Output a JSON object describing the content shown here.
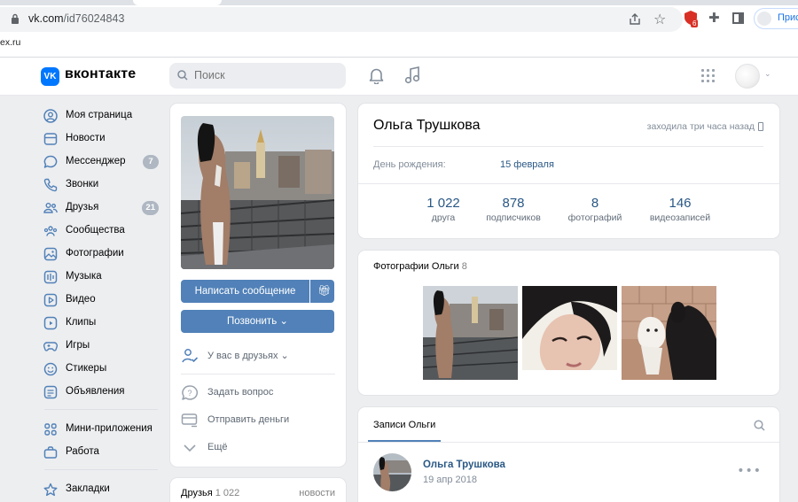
{
  "browser": {
    "url_host": "vk.com",
    "url_path": "/id76024843",
    "extension_badge": "6",
    "profile_label": "Прис",
    "bookmark_text": "ex.ru"
  },
  "header": {
    "logo_text": "VK",
    "brand": "вконтакте",
    "search_placeholder": "Поиск",
    "accent_color": "#0077ff"
  },
  "nav": {
    "items": [
      {
        "label": "Моя страница",
        "icon": "user-circle-icon"
      },
      {
        "label": "Новости",
        "icon": "newspaper-icon"
      },
      {
        "label": "Мессенджер",
        "icon": "chat-bubble-icon",
        "count": "7"
      },
      {
        "label": "Звонки",
        "icon": "phone-icon"
      },
      {
        "label": "Друзья",
        "icon": "users-icon",
        "count": "21"
      },
      {
        "label": "Сообщества",
        "icon": "community-icon"
      },
      {
        "label": "Фотографии",
        "icon": "photo-icon"
      },
      {
        "label": "Музыка",
        "icon": "music-icon"
      },
      {
        "label": "Видео",
        "icon": "video-icon"
      },
      {
        "label": "Клипы",
        "icon": "clips-icon"
      },
      {
        "label": "Игры",
        "icon": "gamepad-icon"
      },
      {
        "label": "Стикеры",
        "icon": "smile-icon"
      },
      {
        "label": "Объявления",
        "icon": "ads-icon"
      },
      {
        "label": "Мини-приложения",
        "icon": "apps-grid-icon"
      },
      {
        "label": "Работа",
        "icon": "briefcase-icon"
      },
      {
        "label": "Закладки",
        "icon": "star-icon"
      }
    ]
  },
  "profile_actions": {
    "message_button": "Написать сообщение",
    "call_button": "Позвонить",
    "friend_status": "У вас в друзьях",
    "ask_question": "Задать вопрос",
    "send_money": "Отправить деньги",
    "more": "Ещё"
  },
  "friends_block": {
    "title": "Друзья",
    "count": "1 022",
    "right_link": "новости"
  },
  "profile": {
    "name": "Ольга Трушкова",
    "last_seen": "заходила три часа назад",
    "birthday_label": "День рождения:",
    "birthday_value": "15 февраля",
    "stats": [
      {
        "value": "1 022",
        "label": "друга"
      },
      {
        "value": "878",
        "label": "подписчиков"
      },
      {
        "value": "8",
        "label": "фотографий"
      },
      {
        "value": "146",
        "label": "видеозаписей"
      }
    ]
  },
  "photos_block": {
    "title": "Фотографии Ольги",
    "count": "8"
  },
  "wall": {
    "tab_label": "Записи Ольги",
    "post": {
      "author": "Ольга Трушкова",
      "date": "19 апр 2018"
    }
  }
}
